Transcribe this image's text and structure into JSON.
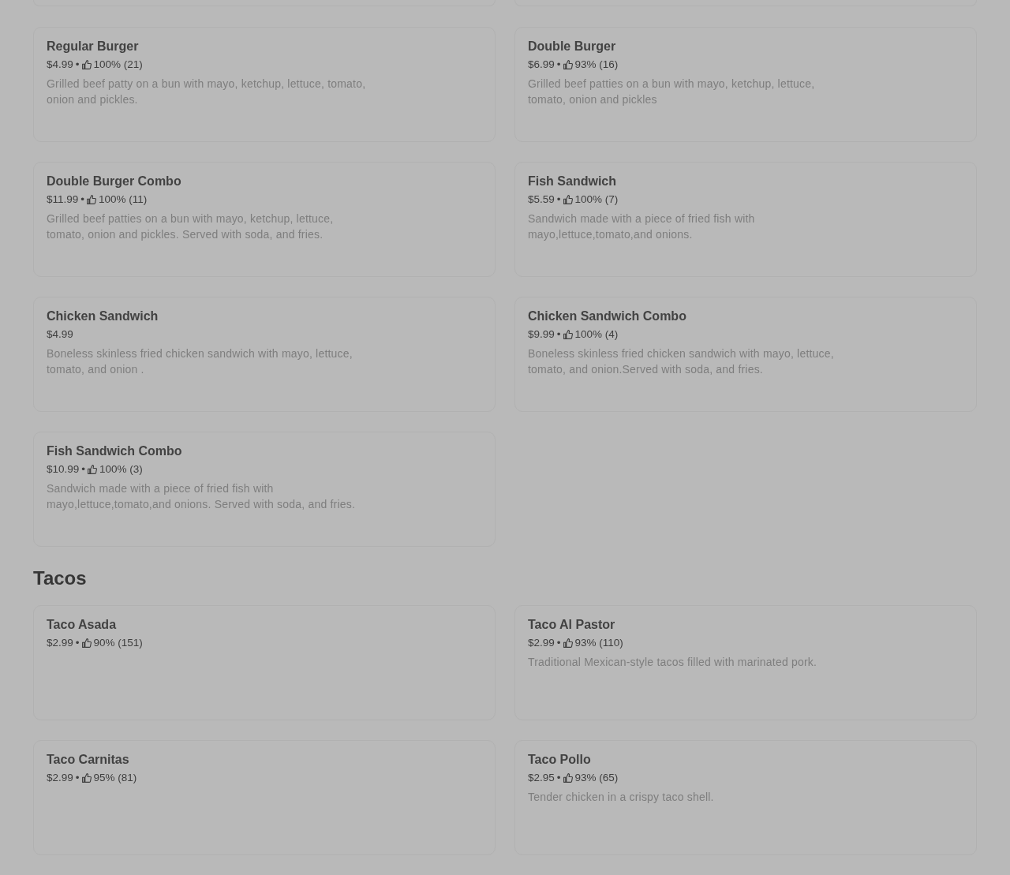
{
  "sections": [
    {
      "items": [
        {
          "name": "Regular Burger",
          "price": "$4.99",
          "separator": "•",
          "rating": "100% (21)",
          "description": "Grilled beef patty on a bun with mayo, ketchup, lettuce, tomato, onion and pickles."
        },
        {
          "name": "Double Burger",
          "price": "$6.99",
          "separator": "•",
          "rating": "93% (16)",
          "description": "Grilled beef patties on a bun with mayo, ketchup, lettuce, tomato, onion and pickles"
        },
        {
          "name": "Double Burger Combo",
          "price": "$11.99",
          "separator": "•",
          "rating": "100% (11)",
          "description": "Grilled beef patties on a bun with mayo, ketchup, lettuce, tomato, onion and pickles. Served with soda, and fries."
        },
        {
          "name": "Fish Sandwich",
          "price": "$5.59",
          "separator": "•",
          "rating": "100% (7)",
          "description": "Sandwich made with a piece of fried fish with mayo,lettuce,tomato,and onions."
        },
        {
          "name": "Chicken Sandwich",
          "price": "$4.99",
          "description": "Boneless skinless fried chicken sandwich with mayo, lettuce, tomato, and onion ."
        },
        {
          "name": "Chicken Sandwich Combo",
          "price": "$9.99",
          "separator": "•",
          "rating": "100% (4)",
          "description": "Boneless skinless fried chicken sandwich with mayo, lettuce, tomato, and onion.Served with soda, and fries."
        },
        {
          "name": "Fish Sandwich Combo",
          "price": "$10.99",
          "separator": "•",
          "rating": "100% (3)",
          "description": "Sandwich made with a piece of fried fish with mayo,lettuce,tomato,and onions. Served with soda, and fries."
        }
      ]
    },
    {
      "title": "Tacos",
      "items": [
        {
          "name": "Taco Asada",
          "price": "$2.99",
          "separator": "•",
          "rating": "90% (151)"
        },
        {
          "name": "Taco Al Pastor",
          "price": "$2.99",
          "separator": "•",
          "rating": "93% (110)",
          "description": "Traditional Mexican-style tacos filled with marinated pork."
        },
        {
          "name": "Taco Carnitas",
          "price": "$2.99",
          "separator": "•",
          "rating": "95% (81)"
        },
        {
          "name": "Taco Pollo",
          "price": "$2.95",
          "separator": "•",
          "rating": "93% (65)",
          "description": "Tender chicken in a crispy taco shell."
        }
      ]
    }
  ]
}
